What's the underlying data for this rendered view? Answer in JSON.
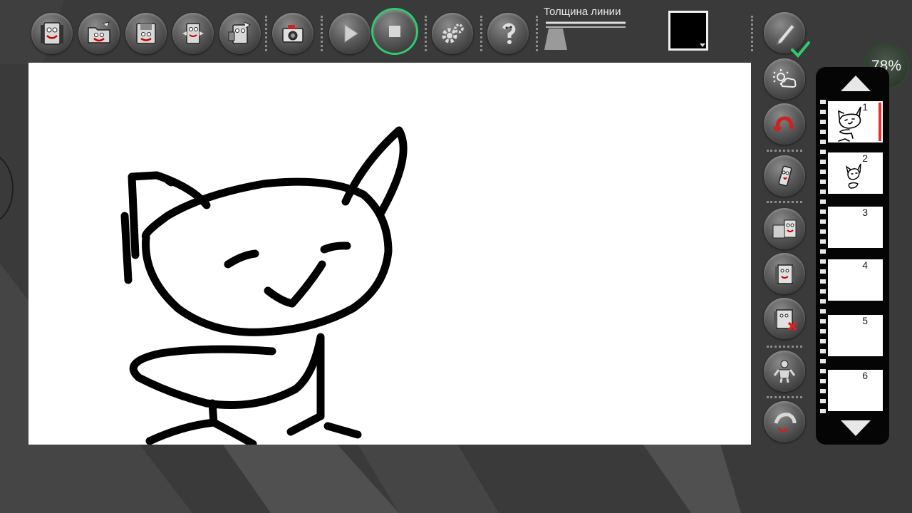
{
  "toolbar": {
    "thickness_label": "Толщина линии",
    "color_swatch": "#000000",
    "zoom": "78%"
  },
  "frames": [
    {
      "number": "1",
      "selected": true
    },
    {
      "number": "2",
      "selected": false
    },
    {
      "number": "3",
      "selected": false
    },
    {
      "number": "4",
      "selected": false
    },
    {
      "number": "5",
      "selected": false
    },
    {
      "number": "6",
      "selected": false
    }
  ],
  "icons": {
    "toolbar": [
      "new-file-icon",
      "open-folder-icon",
      "save-icon",
      "export-icon",
      "share-icon",
      "camera-icon",
      "play-icon",
      "stop-icon",
      "settings-icon",
      "help-icon"
    ],
    "side": [
      "pencil-icon",
      "onion-skin-icon",
      "undo-icon",
      "eraser-icon",
      "copy-frame-icon",
      "add-frame-icon",
      "delete-frame-icon",
      "character-icon",
      "redo-icon"
    ]
  },
  "colors": {
    "accent": "#2ecc71",
    "selection": "#e53030"
  }
}
